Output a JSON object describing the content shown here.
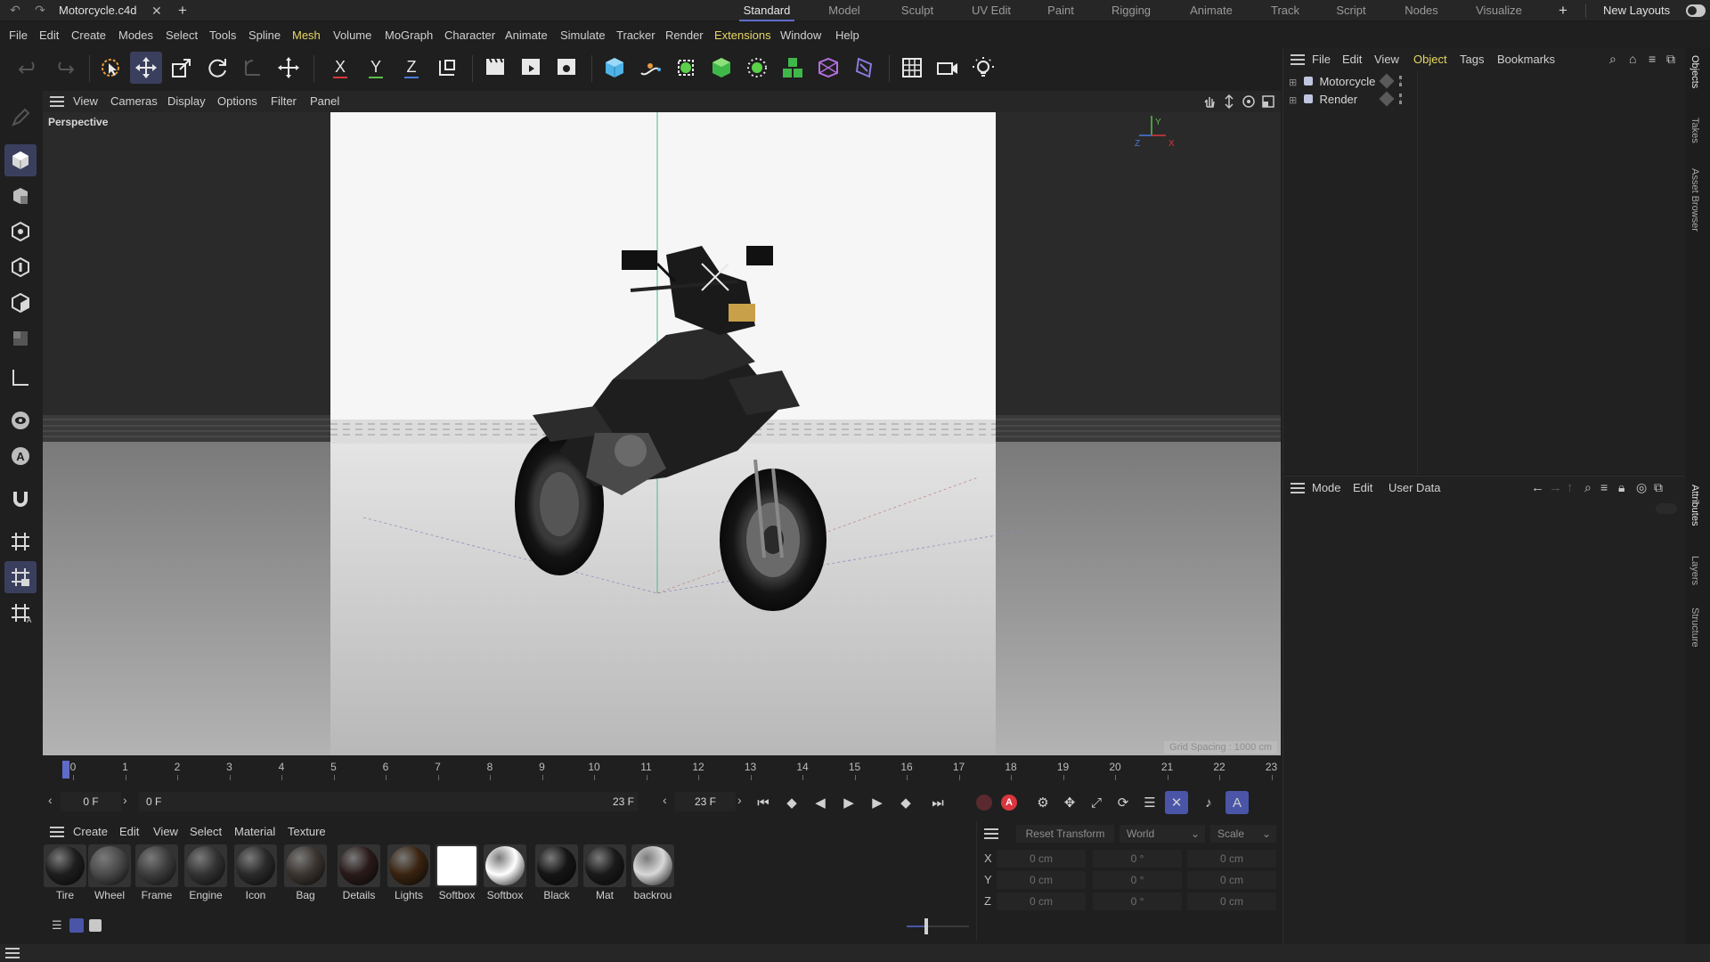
{
  "titlebar": {
    "document": "Motorcycle.c4d",
    "layouts": [
      "Standard",
      "Model",
      "Sculpt",
      "UV Edit",
      "Paint",
      "Rigging",
      "Animate",
      "Track",
      "Script",
      "Nodes",
      "Visualize"
    ],
    "active_layout": "Standard",
    "new_layouts": "New Layouts"
  },
  "menubar": {
    "items": [
      "File",
      "Edit",
      "Create",
      "Modes",
      "Select",
      "Tools",
      "Spline",
      "Mesh",
      "Volume",
      "MoGraph",
      "Character",
      "Animate",
      "Simulate",
      "Tracker",
      "Render",
      "Extensions",
      "Window",
      "Help"
    ]
  },
  "viewport": {
    "menus": [
      "View",
      "Cameras",
      "Display",
      "Options",
      "Filter",
      "Panel"
    ],
    "camera_label": "Perspective",
    "grid_spacing": "Grid Spacing : 1000 cm",
    "axis_x": "X",
    "axis_y": "Y",
    "axis_z": "Z"
  },
  "timeline": {
    "ticks": [
      "0",
      "1",
      "2",
      "3",
      "4",
      "5",
      "6",
      "7",
      "8",
      "9",
      "10",
      "11",
      "12",
      "13",
      "14",
      "15",
      "16",
      "17",
      "18",
      "19",
      "20",
      "21",
      "22",
      "23"
    ],
    "current_frame": "0 F",
    "range_start": "0 F",
    "range_end": "23 F",
    "end_frame": "23 F"
  },
  "materials": {
    "menus": [
      "Create",
      "Edit",
      "View",
      "Select",
      "Material",
      "Texture"
    ],
    "items": [
      {
        "name": "Tire",
        "color": "#1e1e1e"
      },
      {
        "name": "Wheel",
        "color": "#4a4a4a"
      },
      {
        "name": "Frame",
        "color": "#3d3d3d"
      },
      {
        "name": "Engine",
        "color": "#333333"
      },
      {
        "name": "Icon",
        "color": "#2a2a2a"
      },
      {
        "name": "Bag",
        "color": "#3b3530"
      },
      {
        "name": "Details",
        "color": "#2a1a1a"
      },
      {
        "name": "Lights",
        "color": "#3a2410"
      },
      {
        "name": "Softbox",
        "color": "#ffffff"
      },
      {
        "name": "Softbox",
        "color": "#ffffff"
      },
      {
        "name": "Black",
        "color": "#151515"
      },
      {
        "name": "Mat",
        "color": "#1a1a1a"
      },
      {
        "name": "backrou",
        "color": "#d8d8d8"
      }
    ]
  },
  "coordinates": {
    "reset": "Reset Transform",
    "space": "World",
    "mode": "Scale",
    "rows": [
      {
        "axis": "X",
        "pos": "0 cm",
        "rot": "0 °",
        "scale": "0 cm"
      },
      {
        "axis": "Y",
        "pos": "0 cm",
        "rot": "0 °",
        "scale": "0 cm"
      },
      {
        "axis": "Z",
        "pos": "0 cm",
        "rot": "0 °",
        "scale": "0 cm"
      }
    ]
  },
  "objects": {
    "menus": [
      "File",
      "Edit",
      "View",
      "Object",
      "Tags",
      "Bookmarks"
    ],
    "active_menu": "Object",
    "items": [
      "Motorcycle",
      "Render"
    ]
  },
  "attributes": {
    "menus": [
      "Mode",
      "Edit",
      "User Data"
    ]
  },
  "side_tabs": [
    "Objects",
    "Takes",
    "Asset Browser",
    "Attributes",
    "Layers",
    "Structure"
  ],
  "colors": {
    "accent": "#5f6bc9",
    "highlight_menu": "#e8d766",
    "record": "#d9363e"
  }
}
